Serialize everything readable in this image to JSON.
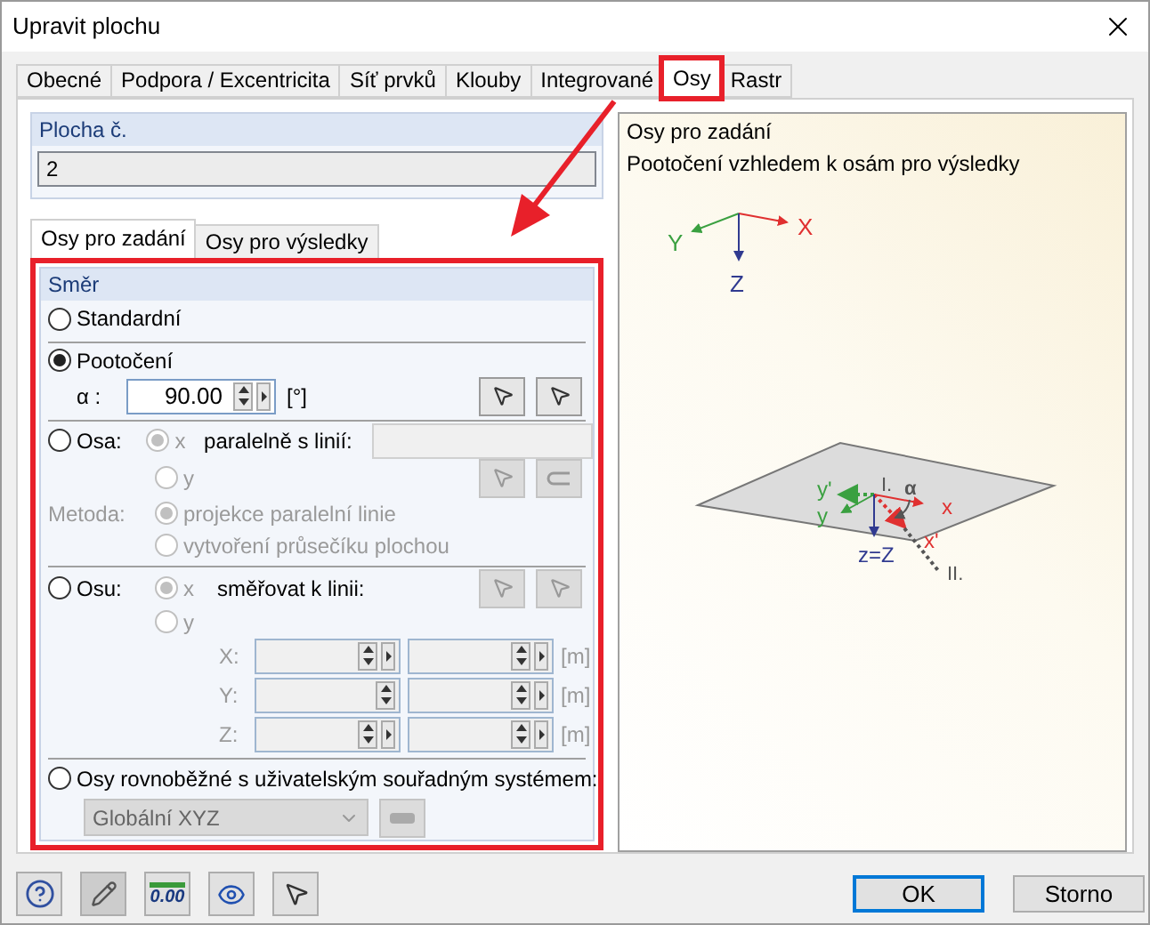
{
  "window": {
    "title": "Upravit plochu"
  },
  "tabs": [
    {
      "label": "Obecné",
      "selected": false,
      "highlighted": false
    },
    {
      "label": "Podpora / Excentricita",
      "selected": false,
      "highlighted": false
    },
    {
      "label": "Síť prvků",
      "selected": false,
      "highlighted": false
    },
    {
      "label": "Klouby",
      "selected": false,
      "highlighted": false
    },
    {
      "label": "Integrované",
      "selected": false,
      "highlighted": false
    },
    {
      "label": "Osy",
      "selected": true,
      "highlighted": true
    },
    {
      "label": "Rastr",
      "selected": false,
      "highlighted": false
    }
  ],
  "surface_number": {
    "label": "Plocha č.",
    "value": "2"
  },
  "subtabs": [
    {
      "label": "Osy pro zadání",
      "selected": true
    },
    {
      "label": "Osy pro výsledky",
      "selected": false
    }
  ],
  "direction": {
    "title": "Směr",
    "highlighted": true,
    "options": [
      {
        "kind": "simple",
        "label": "Standardní",
        "selected": false
      },
      {
        "kind": "rotation",
        "label": "Pootočení",
        "selected": true,
        "angle_label": "α :",
        "value": "90.00",
        "unit": "[°]"
      },
      {
        "kind": "parallel",
        "label": "Osa:",
        "selected": false,
        "axes": [
          {
            "label": "x",
            "selected": true
          },
          {
            "label": "y",
            "selected": false
          }
        ],
        "line_label": "paralelně s linií:",
        "method_label": "Metoda:",
        "methods": [
          {
            "label": "projekce paralelní linie",
            "selected": true
          },
          {
            "label": "vytvoření průsečíku plochou",
            "selected": false
          }
        ]
      },
      {
        "kind": "points",
        "label": "Osu:",
        "selected": false,
        "axes": [
          {
            "label": "x",
            "selected": true
          },
          {
            "label": "y",
            "selected": false
          }
        ],
        "line_label": "směřovat k linii:",
        "coords": [
          {
            "label": "X:",
            "unit": "[m]"
          },
          {
            "label": "Y:",
            "unit": "[m]"
          },
          {
            "label": "Z:",
            "unit": "[m]"
          }
        ]
      },
      {
        "kind": "user_cs",
        "label": "Osy rovnoběžné s uživatelským souřadným systémem:",
        "selected": false,
        "value": "Globální XYZ"
      }
    ]
  },
  "preview": {
    "lines": [
      "Osy pro zadání",
      "Pootočení vzhledem k osám pro výsledky"
    ],
    "global_axes": {
      "x": "X",
      "y": "Y",
      "z": "Z"
    },
    "local_axes": {
      "x": "x",
      "x_rotated": "x'",
      "y": "y",
      "y_rotated": "y'",
      "z": "z=Z",
      "alpha": "α",
      "point_1": "I.",
      "point_2": "II."
    }
  },
  "footer": {
    "decimal_icon_label": "0.00",
    "buttons": [
      {
        "label": "OK",
        "default": true
      },
      {
        "label": "Storno",
        "default": false
      }
    ]
  }
}
